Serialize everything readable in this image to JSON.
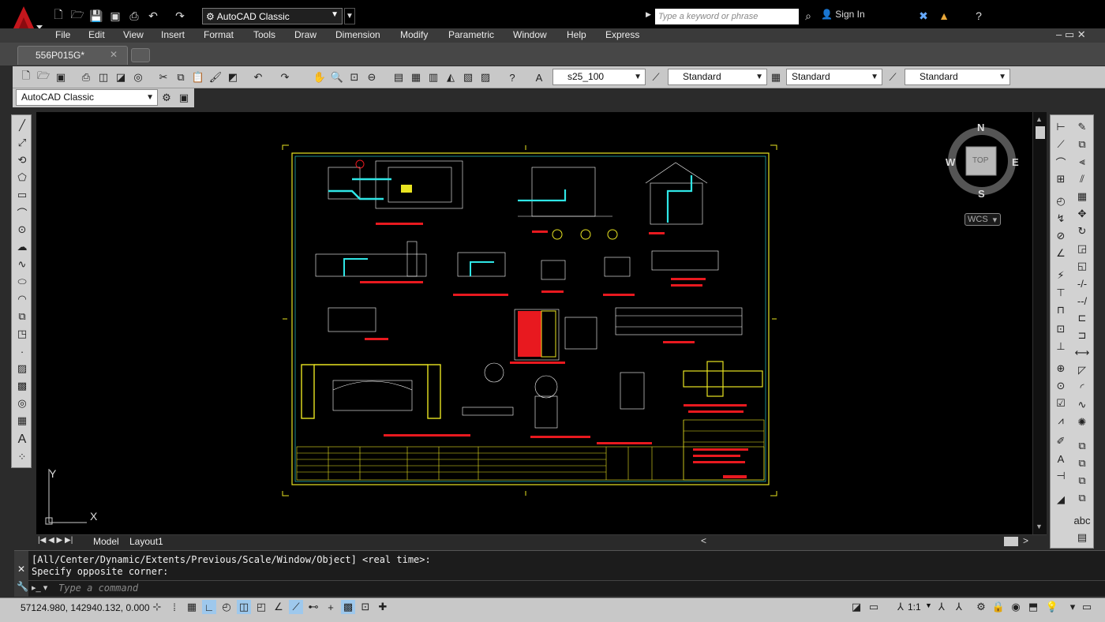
{
  "title_bar": {
    "workspace": "AutoCAD Classic",
    "search_placeholder": "Type a keyword or phrase",
    "sign_in": "Sign In"
  },
  "menu": [
    "File",
    "Edit",
    "View",
    "Insert",
    "Format",
    "Tools",
    "Draw",
    "Dimension",
    "Modify",
    "Parametric",
    "Window",
    "Help",
    "Express"
  ],
  "file_tab": {
    "label": "556P015G*"
  },
  "toolbar": {
    "text_style": "s25_100",
    "dim_style": "Standard",
    "table_style": "Standard",
    "multileader_style": "Standard",
    "workspace_select": "AutoCAD Classic"
  },
  "viewcube": {
    "n": "N",
    "s": "S",
    "e": "E",
    "w": "W",
    "face": "TOP",
    "wcs": "WCS"
  },
  "ucs": {
    "y": "Y",
    "x": "X"
  },
  "layout_tabs": {
    "model": "Model",
    "layout1": "Layout1"
  },
  "command": {
    "history": [
      "[All/Center/Dynamic/Extents/Previous/Scale/Window/Object] <real time>:",
      "Specify opposite corner:"
    ],
    "input_placeholder": "Type a command"
  },
  "status": {
    "coords": "57124.980, 142940.132, 0.000",
    "scale": "1:1"
  },
  "colors": {
    "canvas": "#000000",
    "accent_red": "#e8191f",
    "drawing_yellow": "#e9e421",
    "drawing_cyan": "#2fe6e6"
  }
}
